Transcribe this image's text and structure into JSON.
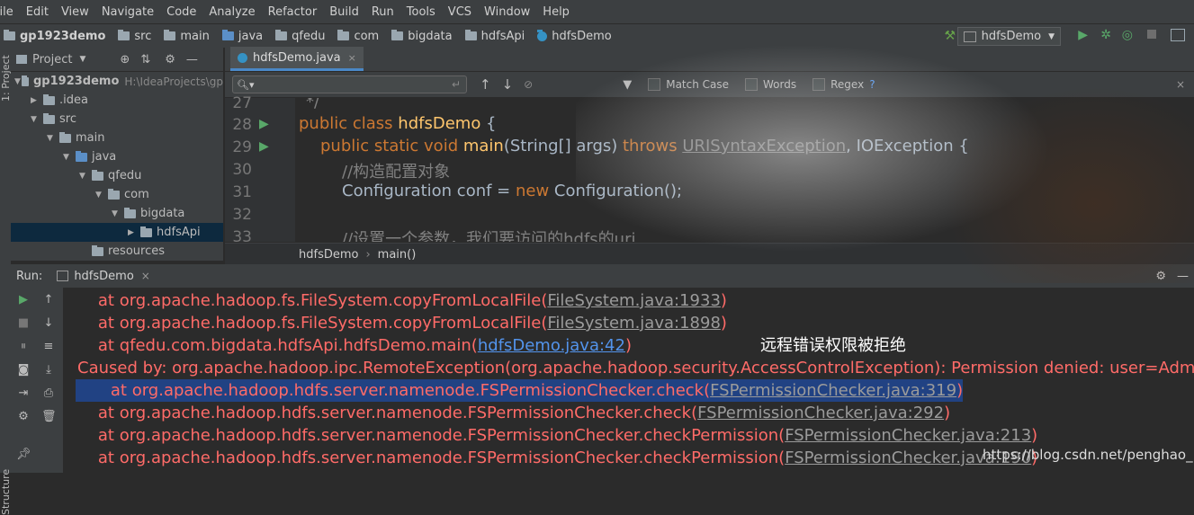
{
  "menu": [
    "File",
    "Edit",
    "View",
    "Navigate",
    "Code",
    "Analyze",
    "Refactor",
    "Build",
    "Run",
    "Tools",
    "VCS",
    "Window",
    "Help"
  ],
  "breadcrumbs": [
    "gp1923demo",
    "src",
    "main",
    "java",
    "qfedu",
    "com",
    "bigdata",
    "hdfsApi",
    "hdfsDemo"
  ],
  "run_config": "hdfsDemo",
  "project_panel": {
    "title": "Project",
    "strip_label": "1: Project",
    "structure_label": "Structure",
    "tree": [
      {
        "label": "gp1923demo",
        "path": "H:\\IdeaProjects\\gp"
      },
      {
        "label": ".idea"
      },
      {
        "label": "src"
      },
      {
        "label": "main"
      },
      {
        "label": "java"
      },
      {
        "label": "qfedu"
      },
      {
        "label": "com"
      },
      {
        "label": "bigdata"
      },
      {
        "label": "hdfsApi"
      },
      {
        "label": "resources"
      }
    ]
  },
  "editor": {
    "tab": "hdfsDemo.java",
    "search": {
      "match_case": "Match Case",
      "words": "Words",
      "regex": "Regex",
      "regex_help": "?"
    },
    "lines": [
      {
        "num": "27",
        "text": "*/"
      },
      {
        "num": "28",
        "kw": "public class ",
        "name": "hdfsDemo",
        "rest": " {"
      },
      {
        "num": "29",
        "kw": "public static void ",
        "name": "main",
        "args": "(String[] args) ",
        "throws": "throws ",
        "ex1": "URISyntaxException",
        "ex2": ", IOException {"
      },
      {
        "num": "30",
        "text": "//构造配置对象"
      },
      {
        "num": "31",
        "pre": "Configuration conf = ",
        "kw": "new ",
        "post": "Configuration();"
      },
      {
        "num": "32",
        "text": ""
      },
      {
        "num": "33",
        "text": "//设置一个参数，我们要访问的hdfs的uri"
      }
    ],
    "crumbs": [
      "hdfsDemo",
      "main()"
    ]
  },
  "run_panel": {
    "label": "Run:",
    "tab": "hdfsDemo",
    "console": [
      {
        "pre": "    at org.apache.hadoop.fs.FileSystem.copyFromLocalFile(",
        "link": "FileSystem.java:1933",
        "post": ")"
      },
      {
        "pre": "    at org.apache.hadoop.fs.FileSystem.copyFromLocalFile(",
        "link": "FileSystem.java:1898",
        "post": ")"
      },
      {
        "pre": "    at qfedu.com.bigdata.hdfsApi.hdfsDemo.main(",
        "link": "hdfsDemo.java:42",
        "post": ")",
        "blue": true
      },
      {
        "pre": "Caused by: org.apache.hadoop.ipc.RemoteException(org.apache.hadoop.security.AccessControlException): Permission denied: user=Admin",
        "link": "",
        "post": ""
      },
      {
        "pre": "    at org.apache.hadoop.hdfs.server.namenode.FSPermissionChecker.check(",
        "link": "FSPermissionChecker.java:319",
        "post": ")",
        "highlight": true
      },
      {
        "pre": "    at org.apache.hadoop.hdfs.server.namenode.FSPermissionChecker.check(",
        "link": "FSPermissionChecker.java:292",
        "post": ")"
      },
      {
        "pre": "    at org.apache.hadoop.hdfs.server.namenode.FSPermissionChecker.checkPermission(",
        "link": "FSPermissionChecker.java:213",
        "post": ")"
      },
      {
        "pre": "    at org.apache.hadoop.hdfs.server.namenode.FSPermissionChecker.checkPermission(",
        "link": "FSPermissionChecker.java:190",
        "post": ")"
      }
    ]
  },
  "annotation": "远程错误权限被拒绝",
  "watermark": "https://blog.csdn.net/penghao_1",
  "colors": {
    "accent": "#4a88c7",
    "error": "#ff6b68",
    "keyword": "#cc7832",
    "function": "#ffc66d"
  }
}
